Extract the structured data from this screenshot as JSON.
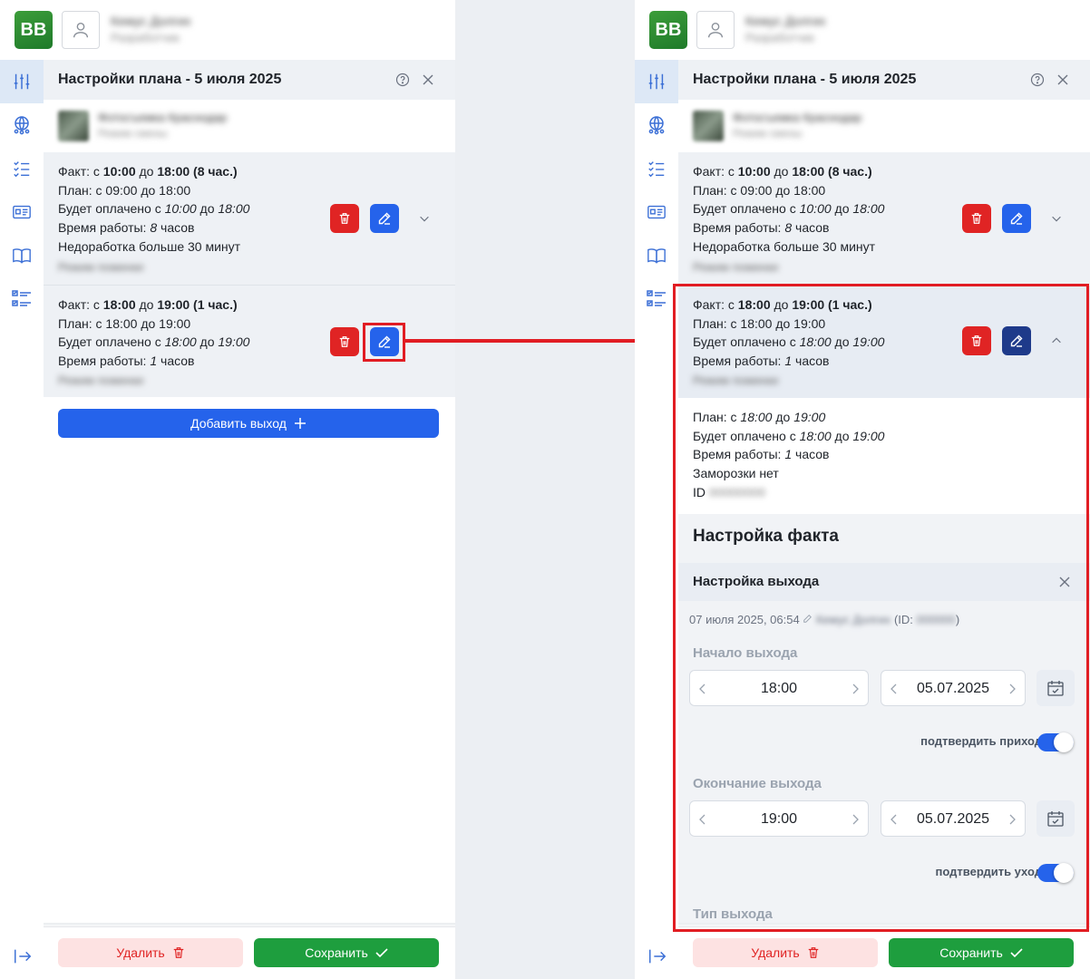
{
  "app": {
    "logo_text": "BB",
    "user_name": "Кемус Долгих",
    "user_role": "Разработчик"
  },
  "plan": {
    "title": "Настройки плана - 5 июля 2025"
  },
  "employee": {
    "name": "Фотосъемка Краснодар",
    "subtitle": "Режим смены"
  },
  "shift1": {
    "fact_prefix": "Факт: с ",
    "fact_from": "10:00",
    "fact_mid": " до ",
    "fact_to": "18:00",
    "fact_dur": " (8 час.)",
    "plan_line": "План: с 09:00 до 18:00",
    "paid_prefix": "Будет оплачено с ",
    "paid_from": "10:00",
    "paid_mid": " до ",
    "paid_to": "18:00",
    "work_prefix": "Время работы: ",
    "work_val": "8",
    "work_suffix": " часов",
    "warning": "Недоработка больше 30 минут",
    "note": "Режим поминки"
  },
  "shift2": {
    "fact_prefix": "Факт: с ",
    "fact_from": "18:00",
    "fact_mid": " до ",
    "fact_to": "19:00",
    "fact_dur": " (1 час.)",
    "plan_line": "План: с 18:00 до 19:00",
    "paid_prefix": "Будет оплачено с ",
    "paid_from": "18:00",
    "paid_mid": " до ",
    "paid_to": "19:00",
    "work_prefix": "Время работы: ",
    "work_val": "1",
    "work_suffix": " часов",
    "note": "Режим поминки"
  },
  "details": {
    "plan_prefix": "План: с ",
    "plan_from": "18:00",
    "plan_mid": " до ",
    "plan_to": "19:00",
    "paid_prefix": "Будет оплачено с ",
    "paid_from": "18:00",
    "paid_mid": " до ",
    "paid_to": "19:00",
    "work_prefix": "Время работы: ",
    "work_val": "1",
    "work_suffix": " часов",
    "freeze": "Заморозки нет",
    "id_label": "ID ",
    "id_val": "00000000"
  },
  "fact_setup": {
    "title": "Настройка факта",
    "exit_title": "Настройка выхода",
    "meta_date": "07 июля 2025, 06:54",
    "meta_user": "Кемус Долгих",
    "meta_id_prefix": "(ID: ",
    "meta_id_val": "000000",
    "meta_id_suffix": ")",
    "start_label": "Начало выхода",
    "start_time": "18:00",
    "start_date": "05.07.2025",
    "confirm_in": "подтвердить приход",
    "end_label": "Окончание выхода",
    "end_time": "19:00",
    "end_date": "05.07.2025",
    "confirm_out": "подтвердить уход",
    "type_label": "Тип выхода"
  },
  "actions": {
    "add_exit": "Добавить выход",
    "delete": "Удалить",
    "save": "Сохранить"
  },
  "colors": {
    "primary": "#2563eb",
    "danger": "#e02424",
    "success": "#1e9e3e",
    "annotation": "#e11d23"
  }
}
